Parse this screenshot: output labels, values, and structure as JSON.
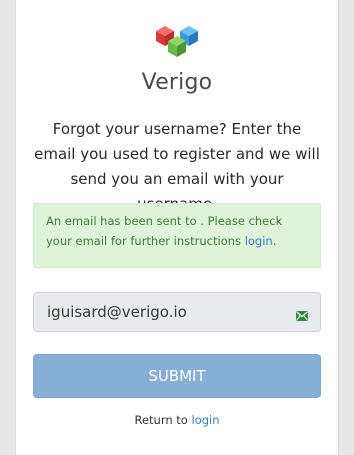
{
  "brand": {
    "name": "Verigo",
    "logo_icon": "verigo-cubes-logo",
    "colors": {
      "red": "#e2443f",
      "green": "#66b94a",
      "blue": "#3a9be0"
    }
  },
  "intro_text": "Forgot your username? Enter the email you used to register and we will send you an email with your username.",
  "alert": {
    "message": "An email has been sent to . Please check your email for further instructions ",
    "link_label": "login",
    "end_punct": ".",
    "background": "#def3da",
    "text_color": "#3f7d37"
  },
  "email_field": {
    "value": "iguisard@verigo.io",
    "icon": "envelope-icon"
  },
  "submit": {
    "label": "SUBMIT",
    "color": "#86afd3"
  },
  "footer": {
    "prefix": "Return to ",
    "link_label": "login"
  }
}
